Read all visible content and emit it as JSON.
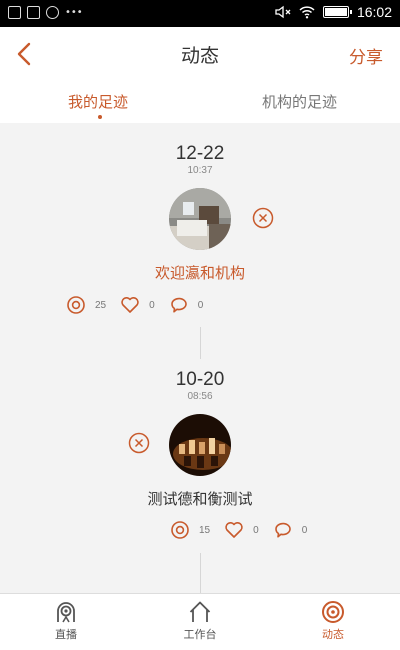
{
  "status_bar": {
    "time": "16:02"
  },
  "header": {
    "title": "动态",
    "share_label": "分享"
  },
  "tabs": [
    {
      "label": "我的足迹",
      "active": true
    },
    {
      "label": "机构的足迹",
      "active": false
    }
  ],
  "entries": [
    {
      "date": "12-22",
      "time": "10:37",
      "title": "欢迎瀛和机构",
      "views": "25",
      "likes": "0",
      "comments": "0"
    },
    {
      "date": "10-20",
      "time": "08:56",
      "title": "测试德和衡测试",
      "views": "15",
      "likes": "0",
      "comments": "0"
    }
  ],
  "bottom_nav": [
    {
      "label": "直播",
      "icon": "live-icon",
      "active": false
    },
    {
      "label": "工作台",
      "icon": "home-icon",
      "active": false
    },
    {
      "label": "动态",
      "icon": "target-icon",
      "active": true
    }
  ],
  "colors": {
    "accent": "#c85a2c",
    "background": "#f3f3f3"
  }
}
